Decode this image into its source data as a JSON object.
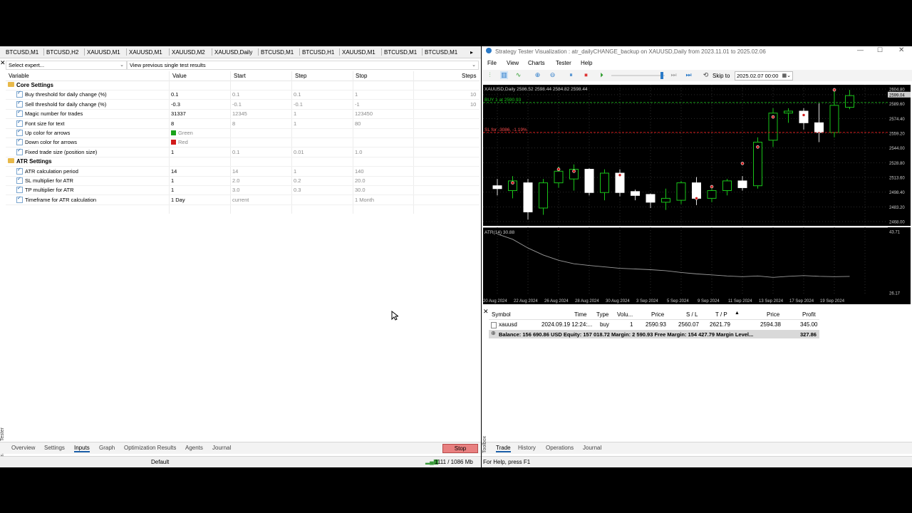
{
  "left": {
    "chart_tabs": [
      "BTCUSD,M1",
      "BTCUSD,H2",
      "XAUUSD,M1",
      "XAUUSD,M1",
      "XAUUSD,M2",
      "XAUUSD,Daily",
      "BTCUSD,M1",
      "BTCUSD,H1",
      "XAUUSD,M1",
      "BTCUSD,M1",
      "BTCUSD,M1"
    ],
    "expert_placeholder": "Select expert...",
    "results_combo": "View previous single test results",
    "columns": {
      "variable": "Variable",
      "value": "Value",
      "start": "Start",
      "step": "Step",
      "stop": "Stop",
      "steps": "Steps"
    },
    "groups": [
      {
        "name": "Core Settings",
        "rows": [
          {
            "label": "Buy threshold for daily change (%)",
            "value": "0.1",
            "start": "0.1",
            "step": "0.1",
            "stop": "1",
            "steps": "10"
          },
          {
            "label": "Sell threshold for daily change (%)",
            "value": "-0.3",
            "start": "-0.1",
            "step": "-0.1",
            "stop": "-1",
            "steps": "10"
          },
          {
            "label": "Magic number for trades",
            "value": "31337",
            "start": "12345",
            "step": "1",
            "stop": "123450",
            "steps": ""
          },
          {
            "label": "Font size for text",
            "value": "8",
            "start": "8",
            "step": "1",
            "stop": "80",
            "steps": ""
          },
          {
            "label": "Up color for arrows",
            "value": "",
            "swatch": "#1aa31a",
            "start": "Green",
            "step": "",
            "stop": "",
            "steps": ""
          },
          {
            "label": "Down color for arrows",
            "value": "",
            "swatch": "#d11a1a",
            "start": "Red",
            "step": "",
            "stop": "",
            "steps": ""
          },
          {
            "label": "Fixed trade size (position size)",
            "value": "1",
            "start": "0.1",
            "step": "0.01",
            "stop": "1.0",
            "steps": ""
          }
        ]
      },
      {
        "name": "ATR Settings",
        "rows": [
          {
            "label": "ATR calculation period",
            "value": "14",
            "start": "14",
            "step": "1",
            "stop": "140",
            "steps": ""
          },
          {
            "label": "SL multiplier for ATR",
            "value": "1",
            "start": "2.0",
            "step": "0.2",
            "stop": "20.0",
            "steps": ""
          },
          {
            "label": "TP multiplier for ATR",
            "value": "1",
            "start": "3.0",
            "step": "0.3",
            "stop": "30.0",
            "steps": ""
          },
          {
            "label": "Timeframe for ATR calculation",
            "value": "1 Day",
            "start": "current",
            "step": "",
            "stop": "1 Month",
            "steps": ""
          }
        ]
      }
    ],
    "side_label": "Strategy Tester",
    "bottom_tabs": [
      "Overview",
      "Settings",
      "Inputs",
      "Graph",
      "Optimization Results",
      "Agents",
      "Journal"
    ],
    "active_tab": "Inputs",
    "stop_label": "Stop",
    "status_profile": "Default",
    "status_memory": "1111 / 1086 Mb"
  },
  "right": {
    "window_title": "Strategy Tester Visualization : atr_dailyCHANGE_backup on XAUUSD,Daily from 2023.11.01 to 2025.02.06",
    "menu": [
      "File",
      "View",
      "Charts",
      "Tester",
      "Help"
    ],
    "skip_to_label": "Skip to",
    "skip_to_value": "2025.02.07 00:00",
    "chart_header": "XAUUSD,Daily  2586.52 2598.44 2584.82 2598.44",
    "buy_label": "BUY 1 at 2590.93",
    "sl_label": "SL for -3086, -1.19%",
    "atr_label": "ATR(14) 30.88",
    "price_ticks": [
      "2604.80",
      "2599.04",
      "2589.60",
      "2574.40",
      "2559.20",
      "2544.00",
      "2528.80",
      "2513.60",
      "2498.40",
      "2483.20",
      "2468.00"
    ],
    "price_highlight": "2599.04",
    "atr_ticks": [
      "43.71",
      "26.17"
    ],
    "date_ticks": [
      "20 Aug 2024",
      "22 Aug 2024",
      "26 Aug 2024",
      "28 Aug 2024",
      "30 Aug 2024",
      "3 Sep 2024",
      "5 Sep 2024",
      "9 Sep 2024",
      "11 Sep 2024",
      "13 Sep 2024",
      "17 Sep 2024",
      "19 Sep 2024"
    ],
    "trade_columns": {
      "symbol": "Symbol",
      "time": "Time",
      "type": "Type",
      "volume": "Volu...",
      "price": "Price",
      "sl": "S / L",
      "tp": "T / P",
      "price2": "Price",
      "profit": "Profit"
    },
    "trade_row": {
      "symbol": "xauusd",
      "time": "2024.09.19 12:24:...",
      "type": "buy",
      "volume": "1",
      "price": "2590.93",
      "sl": "2560.07",
      "tp": "2621.79",
      "price2": "2594.38",
      "profit": "345.00"
    },
    "balance_line": "Balance: 156 690.86 USD  Equity: 157 018.72  Margin: 2 590.93  Free Margin: 154 427.79  Margin Level...",
    "balance_profit": "327.86",
    "toolbox_label": "Toolbox",
    "toolbox_tabs": [
      "Trade",
      "History",
      "Operations",
      "Journal"
    ],
    "active_toolbox_tab": "Trade",
    "status_help": "For Help, press F1"
  },
  "candles": [
    {
      "o": 2505,
      "h": 2512,
      "l": 2495,
      "c": 2502
    },
    {
      "o": 2500,
      "h": 2515,
      "l": 2492,
      "c": 2510
    },
    {
      "o": 2508,
      "h": 2512,
      "l": 2470,
      "c": 2478
    },
    {
      "o": 2482,
      "h": 2512,
      "l": 2475,
      "c": 2508
    },
    {
      "o": 2508,
      "h": 2525,
      "l": 2503,
      "c": 2520
    },
    {
      "o": 2512,
      "h": 2527,
      "l": 2500,
      "c": 2522
    },
    {
      "o": 2522,
      "h": 2523,
      "l": 2495,
      "c": 2498
    },
    {
      "o": 2498,
      "h": 2522,
      "l": 2490,
      "c": 2518
    },
    {
      "o": 2518,
      "h": 2522,
      "l": 2494,
      "c": 2498
    },
    {
      "o": 2499,
      "h": 2501,
      "l": 2490,
      "c": 2495
    },
    {
      "o": 2496,
      "h": 2497,
      "l": 2482,
      "c": 2488
    },
    {
      "o": 2488,
      "h": 2502,
      "l": 2480,
      "c": 2492
    },
    {
      "o": 2490,
      "h": 2510,
      "l": 2486,
      "c": 2508
    },
    {
      "o": 2508,
      "h": 2514,
      "l": 2485,
      "c": 2492
    },
    {
      "o": 2492,
      "h": 2502,
      "l": 2488,
      "c": 2500
    },
    {
      "o": 2500,
      "h": 2512,
      "l": 2495,
      "c": 2510
    },
    {
      "o": 2510,
      "h": 2515,
      "l": 2500,
      "c": 2503
    },
    {
      "o": 2505,
      "h": 2555,
      "l": 2502,
      "c": 2550
    },
    {
      "o": 2552,
      "h": 2585,
      "l": 2545,
      "c": 2580
    },
    {
      "o": 2580,
      "h": 2585,
      "l": 2570,
      "c": 2582
    },
    {
      "o": 2582,
      "h": 2585,
      "l": 2563,
      "c": 2570
    },
    {
      "o": 2570,
      "h": 2590,
      "l": 2550,
      "c": 2560
    },
    {
      "o": 2560,
      "h": 2605,
      "l": 2555,
      "c": 2588
    },
    {
      "o": 2586,
      "h": 2604,
      "l": 2584,
      "c": 2598
    }
  ],
  "atr_series": [
    43.0,
    41.5,
    39.0,
    37.0,
    35.5,
    34.5,
    34.0,
    33.6,
    33.2,
    33.0,
    32.8,
    32.5,
    32.0,
    31.6,
    31.3,
    31.0,
    30.8,
    31.0,
    30.6,
    30.9,
    31.1,
    30.9,
    30.8,
    30.88
  ]
}
